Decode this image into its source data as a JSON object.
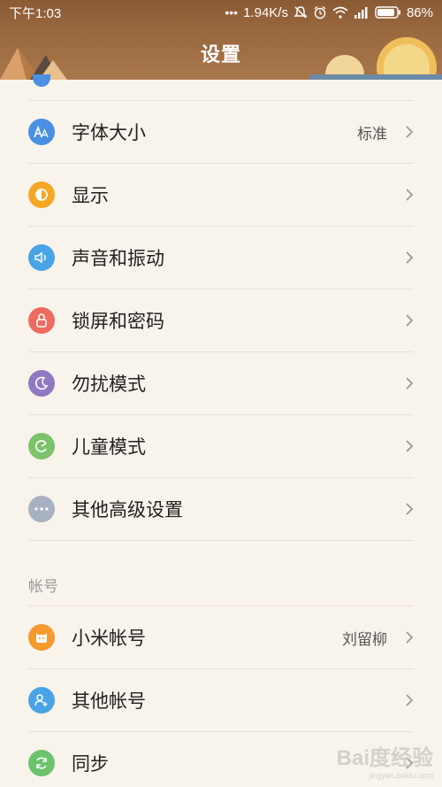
{
  "status_bar": {
    "time": "下午1:03",
    "speed": "1.94K/s",
    "battery": "86%"
  },
  "header": {
    "title": "设置"
  },
  "colors": {
    "header_brown": "#9b6a40",
    "background": "#f8f3eb",
    "blue": "#4a90e2",
    "orange": "#f5a623",
    "red": "#ee6b60",
    "purple": "#8e79c2",
    "green": "#7cc36a",
    "gray": "#a7b1c2",
    "mi_orange": "#f49a2e",
    "sky_blue": "#4aa3e6",
    "sync_green": "#6cc36c"
  },
  "settings": [
    {
      "label": "字体大小",
      "value": "标准",
      "icon": "font-size-icon"
    },
    {
      "label": "显示",
      "value": "",
      "icon": "display-icon"
    },
    {
      "label": "声音和振动",
      "value": "",
      "icon": "speaker-icon"
    },
    {
      "label": "锁屏和密码",
      "value": "",
      "icon": "lock-icon"
    },
    {
      "label": "勿扰模式",
      "value": "",
      "icon": "moon-icon"
    },
    {
      "label": "儿童模式",
      "value": "",
      "icon": "kid-mode-icon"
    },
    {
      "label": "其他高级设置",
      "value": "",
      "icon": "more-dots-icon"
    }
  ],
  "account_section": {
    "title": "帐号",
    "items": [
      {
        "label": "小米帐号",
        "value": "刘留柳",
        "icon": "mi-account-icon"
      },
      {
        "label": "其他帐号",
        "value": "",
        "icon": "add-user-icon"
      },
      {
        "label": "同步",
        "value": "",
        "icon": "sync-icon"
      }
    ]
  },
  "watermark": {
    "text": "Bai度经验",
    "sub": "jingyan.baidu.com"
  }
}
